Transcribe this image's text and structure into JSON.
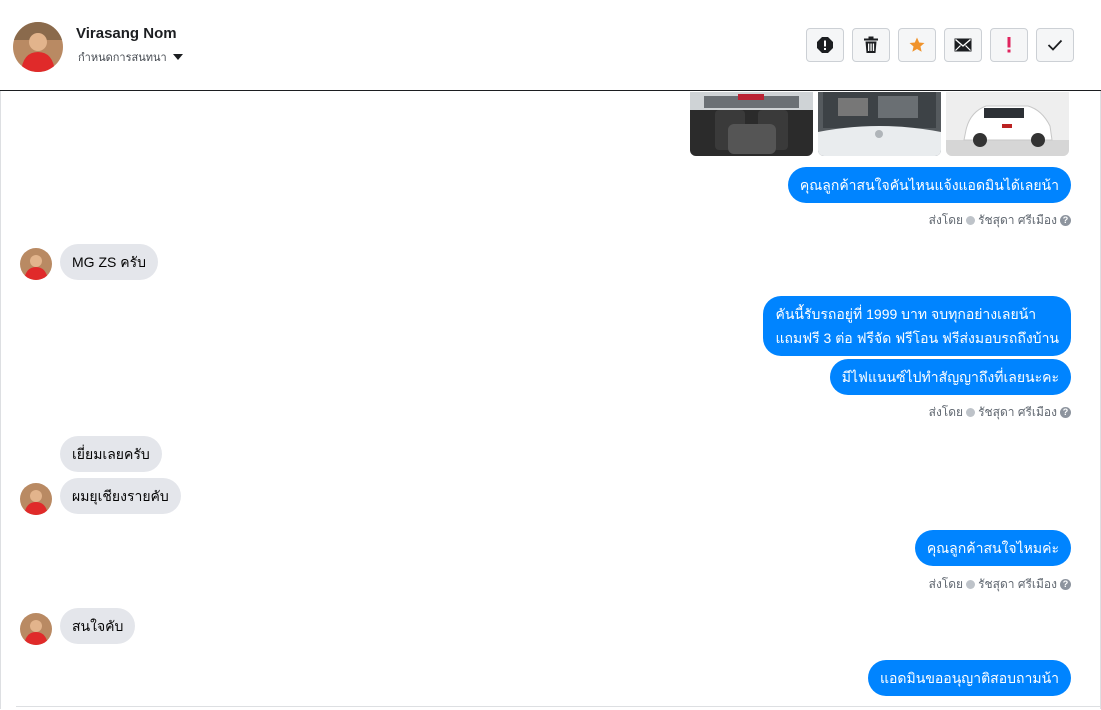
{
  "header": {
    "contact_name": "Virasang Nom",
    "conversation_setting": "กำหนดการสนทนา"
  },
  "toolbar": [
    {
      "icon": "alert-circle-icon",
      "label": ""
    },
    {
      "icon": "trash-icon",
      "label": ""
    },
    {
      "icon": "star-icon",
      "label": ""
    },
    {
      "icon": "mail-icon",
      "label": ""
    },
    {
      "icon": "exclamation-icon",
      "label": ""
    },
    {
      "icon": "check-icon",
      "label": ""
    }
  ],
  "colors": {
    "outgoing_bubble": "#0084ff",
    "incoming_bubble": "#e4e6eb",
    "star": "#f0932b",
    "exclamation": "#e0245e"
  },
  "messages": {
    "m1": "คุณลูกค้าสนใจคันไหนแจ้งแอดมินได้เลยน้า",
    "meta1": {
      "sent_by": "ส่งโดย",
      "agent": "รัชสุดา ศรีเมือง"
    },
    "m2": "MG ZS ครับ",
    "m3_line1": "คันนี้รับรถอยู่ที่ 1999 บาท จบทุกอย่างเลยน้า",
    "m3_line2": "แถมฟรี 3 ต่อ ฟรีจัด ฟรีโอน  ฟรีส่งมอบรถถึงบ้าน",
    "m4": "มีไฟแนนซ์ไปทำสัญญาถึงที่เลยนะคะ",
    "meta2": {
      "sent_by": "ส่งโดย",
      "agent": "รัชสุดา ศรีเมือง"
    },
    "m5": "เยี่ยมเลยครับ",
    "m6": "ผมยุเชียงรายคับ",
    "m7": "คุณลูกค้าสนใจไหมค่ะ",
    "meta3": {
      "sent_by": "ส่งโดย",
      "agent": "รัชสุดา ศรีเมือง"
    },
    "m8": "สนใจคับ",
    "m9": "แอดมินขออนุญาติสอบถามน้า"
  }
}
